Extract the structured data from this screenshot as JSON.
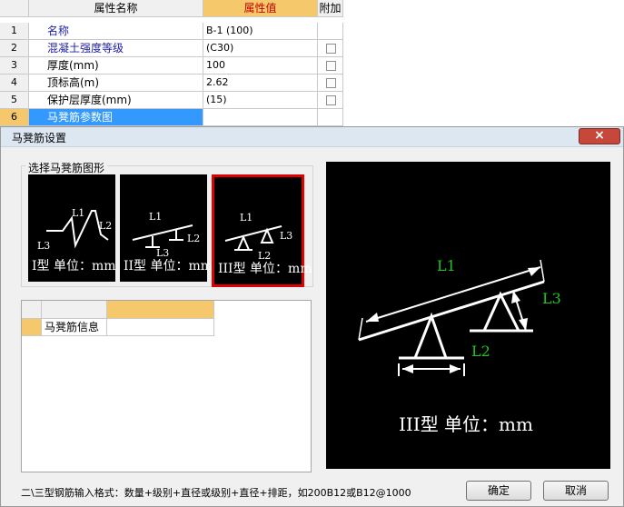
{
  "grid": {
    "headers": {
      "name": "属性名称",
      "value": "属性值",
      "extra": "附加"
    },
    "rows": [
      {
        "num": "1",
        "name": "名称",
        "value": "B-1 (100)",
        "checkbox": false
      },
      {
        "num": "2",
        "name": "混凝土强度等级",
        "value": "(C30)",
        "checkbox": true
      },
      {
        "num": "3",
        "name": "厚度(mm)",
        "value": "100",
        "checkbox": true
      },
      {
        "num": "4",
        "name": "顶标高(m)",
        "value": "2.62",
        "checkbox": true
      },
      {
        "num": "5",
        "name": "保护层厚度(mm)",
        "value": "(15)",
        "checkbox": true
      },
      {
        "num": "6",
        "name": "马凳筋参数图",
        "value": "",
        "checkbox": false
      }
    ]
  },
  "dialog": {
    "title": "马凳筋设置",
    "close_label": "×",
    "shape_group_label": "选择马凳筋图形",
    "shapes": [
      {
        "label": "I型 单位：mm",
        "l1": "L1",
        "l2": "L2",
        "l3": "L3"
      },
      {
        "label": "II型 单位：mm",
        "l1": "L1",
        "l2": "L2",
        "l3": "L3"
      },
      {
        "label": "III型 单位：mm",
        "l1": "L1",
        "l2": "L2",
        "l3": "L3"
      }
    ],
    "selected_shape": 2,
    "info_grid": {
      "row_label": "马凳筋信息"
    },
    "preview": {
      "l1": "L1",
      "l2": "L2",
      "l3": "L3",
      "caption": "III型 单位：mm"
    },
    "status_text": "二\\三型钢筋输入格式：数量+级别+直径或级别+直径+排距，如200B12或B12@1000",
    "ok_label": "确定",
    "cancel_label": "取消"
  },
  "colors": {
    "accent": "#f5c86c",
    "selection": "#3399ff",
    "label_green": "#22c322",
    "selected_border": "#e00000"
  }
}
